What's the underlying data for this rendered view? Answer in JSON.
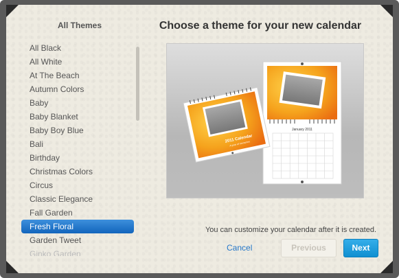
{
  "sidebar": {
    "title": "All Themes",
    "themes": [
      "All Black",
      "All White",
      "At The Beach",
      "Autumn Colors",
      "Baby",
      "Baby Blanket",
      "Baby Boy Blue",
      "Bali",
      "Birthday",
      "Christmas Colors",
      "Circus",
      "Classic Elegance",
      "Fall Garden",
      "Fresh Floral",
      "Garden Tweet",
      "Ginko Garden"
    ],
    "selected": "Fresh Floral"
  },
  "main": {
    "title": "Choose a theme for your new calendar",
    "preview": {
      "cover_title": "2011 Calendar",
      "cover_subtitle": "A year of memories",
      "month_label": "January 2011"
    },
    "note": "You can customize your calendar after it is created."
  },
  "actions": {
    "cancel_label": "Cancel",
    "previous_label": "Previous",
    "next_label": "Next"
  },
  "colors": {
    "selection": "#1a6fc7",
    "next_button": "#1a9ddf",
    "cancel_link": "#2577c9",
    "theme_orange": "#f29a1c"
  }
}
